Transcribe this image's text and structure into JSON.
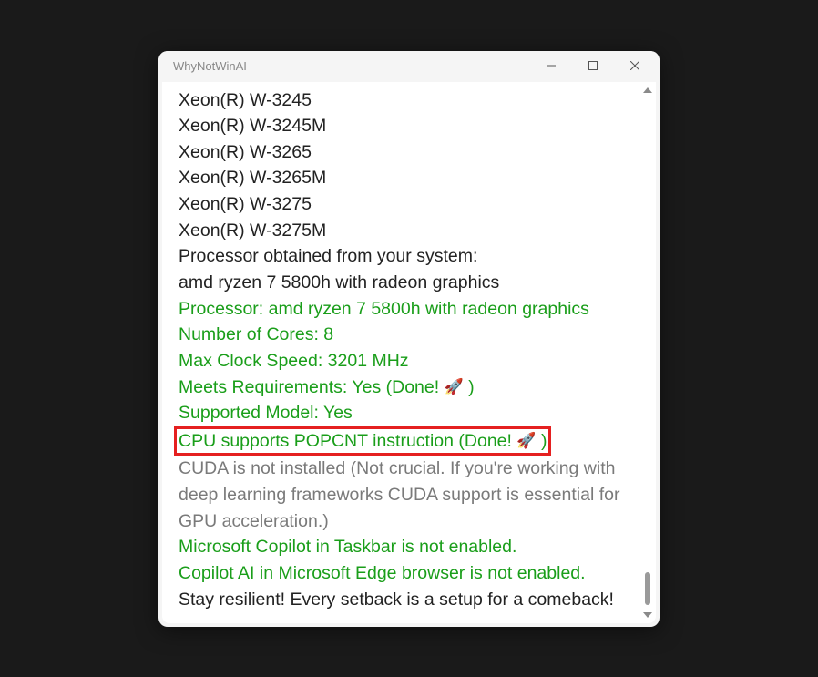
{
  "window": {
    "title": "WhyNotWinAI"
  },
  "lines": {
    "l0": "Xeon(R) W-3245",
    "l1": "Xeon(R) W-3245M",
    "l2": "Xeon(R) W-3265",
    "l3": "Xeon(R) W-3265M",
    "l4": "Xeon(R) W-3275",
    "l5": "Xeon(R) W-3275M",
    "l6": "Processor obtained from your system:",
    "l7": "amd ryzen 7 5800h with radeon graphics",
    "l8": "Processor: amd ryzen 7 5800h with radeon graphics",
    "l9": "Number of Cores: 8",
    "l10": "Max Clock Speed: 3201 MHz",
    "l11a": "Meets Requirements: Yes (Done! ",
    "l11b": " )",
    "l12": "Supported Model: Yes",
    "l13a": "CPU supports POPCNT instruction (Done! ",
    "l13b": " )",
    "l14": "CUDA is not installed (Not crucial. If you're working with deep learning frameworks CUDA support is essential for GPU acceleration.)",
    "l15": "Microsoft Copilot in Taskbar is not enabled.",
    "l16": "Copilot AI in Microsoft Edge browser is not enabled.",
    "l17": "Stay resilient! Every setback is a setup for a comeback!"
  },
  "icons": {
    "rocket": "🚀"
  }
}
